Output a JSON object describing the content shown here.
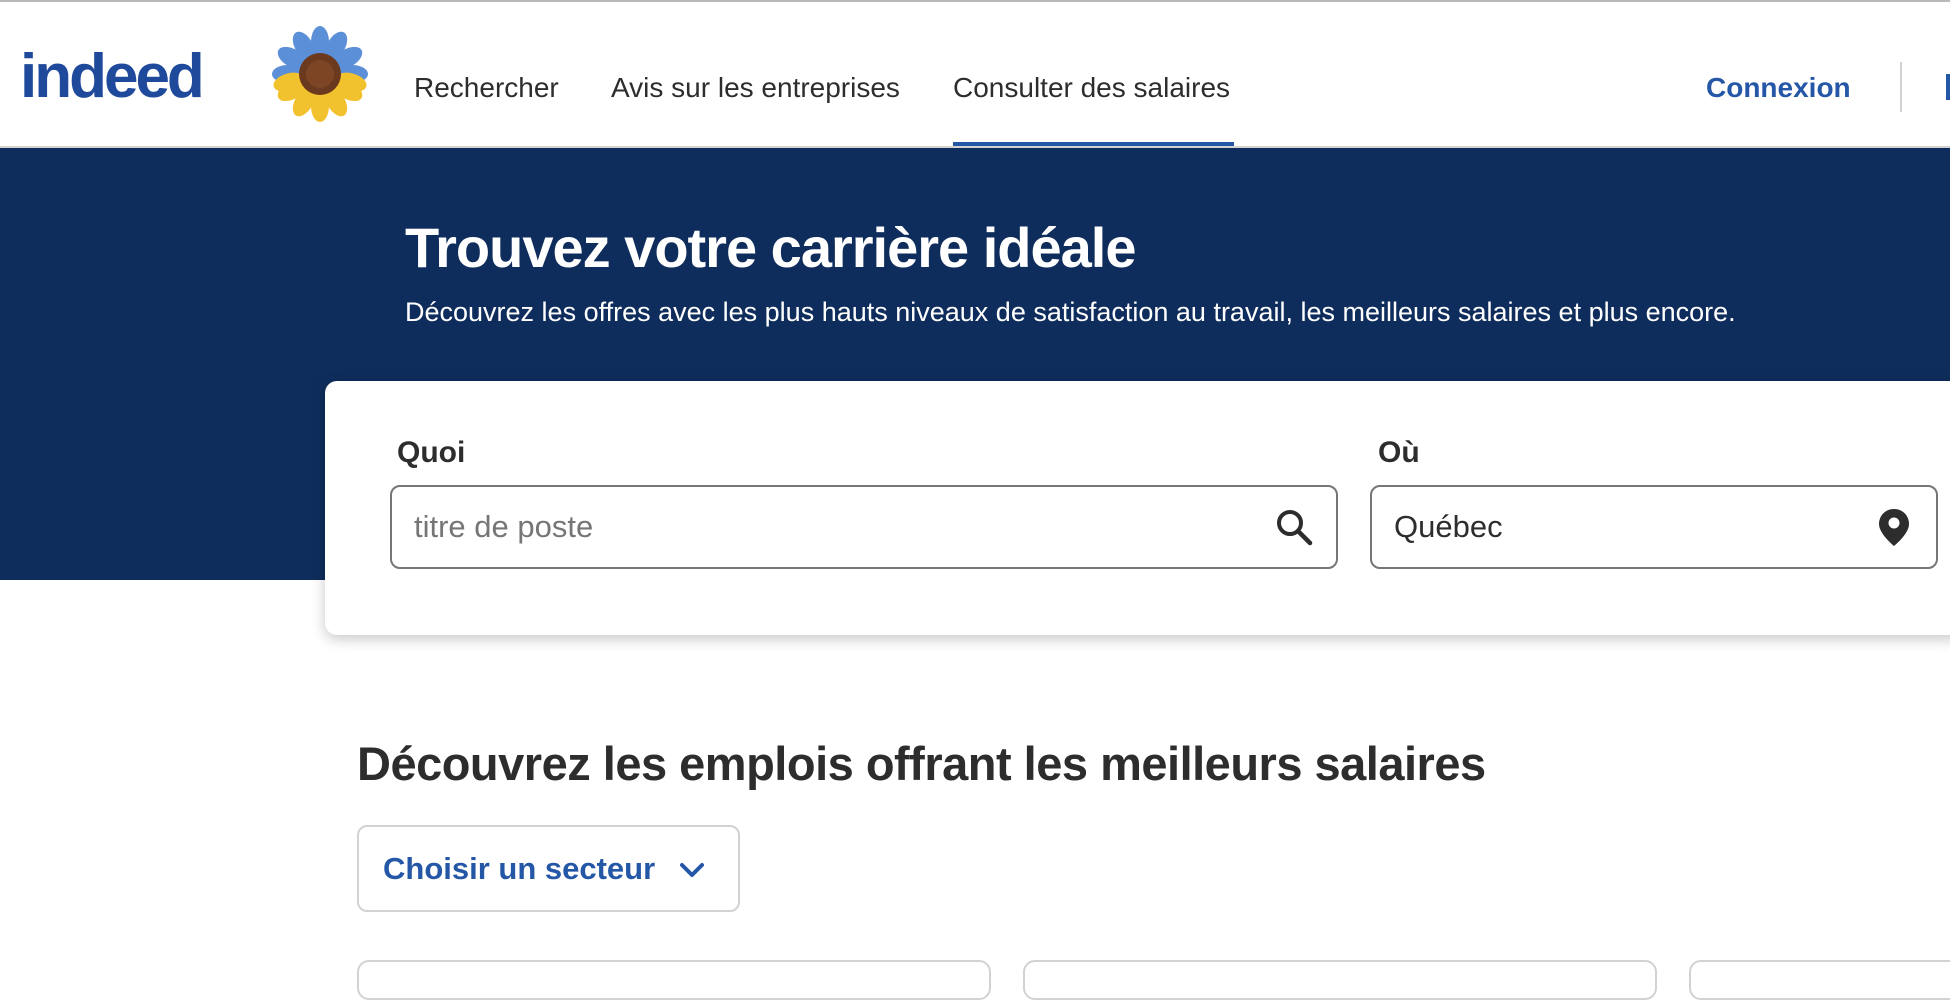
{
  "header": {
    "logo_text": "indeed",
    "nav": {
      "rechercher": "Rechercher",
      "avis": "Avis sur les entreprises",
      "salaires": "Consulter des salaires"
    },
    "active_nav": "Consulter des salaires",
    "connexion": "Connexion"
  },
  "hero": {
    "title": "Trouvez votre carrière idéale",
    "subtitle": "Découvrez les offres avec les plus hauts niveaux de satisfaction au travail, les meilleurs salaires et plus encore."
  },
  "search": {
    "what_label": "Quoi",
    "what_placeholder": "titre de poste",
    "what_value": "",
    "where_label": "Où",
    "where_value": "Québec",
    "what_icon": "search-icon",
    "where_icon": "location-pin-icon"
  },
  "section": {
    "heading": "Découvrez les emplois offrant les meilleurs salaires",
    "sector_button": "Choisir un secteur",
    "sector_icon": "chevron-down-icon"
  },
  "colors": {
    "brand_blue": "#2557a7",
    "hero_navy": "#0f2d5c",
    "text_dark": "#2d2d2d"
  }
}
